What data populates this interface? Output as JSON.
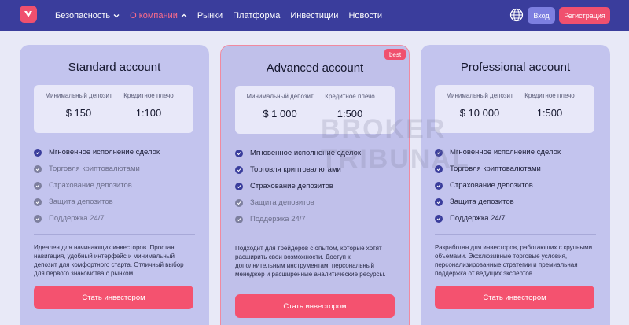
{
  "header": {
    "nav": [
      {
        "label": "Безопасность",
        "has_chevron": true,
        "active": false
      },
      {
        "label": "О компании",
        "has_chevron": true,
        "active": true
      },
      {
        "label": "Рынки"
      },
      {
        "label": "Платформа"
      },
      {
        "label": "Инвестиции"
      },
      {
        "label": "Новости"
      }
    ],
    "login_label": "Вход",
    "register_label": "Регистрация",
    "colors": {
      "bar": "#3a3d9c",
      "accent": "#f0506e",
      "active_nav": "#ff6d8a"
    }
  },
  "watermark": {
    "line1": "BROKER",
    "line2": "TRIBUNAL"
  },
  "cards": [
    {
      "title": "Standard account",
      "min_deposit_label": "Минимальный депозит",
      "min_deposit_value": "$ 150",
      "leverage_label": "Кредитное плечо",
      "leverage_value": "1:100",
      "features": [
        {
          "label": "Мгновенное исполнение сделок",
          "included": true
        },
        {
          "label": "Торговля криптовалютами",
          "included": false
        },
        {
          "label": "Страхование депозитов",
          "included": false
        },
        {
          "label": "Защита депозитов",
          "included": false
        },
        {
          "label": "Поддержка 24/7",
          "included": false
        }
      ],
      "description": "Идеален для начинающих инвесторов. Простая навигация, удобный интерфейс и минимальный депозит для комфортного старта. Отличный выбор для первого знакомства с рынком.",
      "cta_label": "Стать инвестором"
    },
    {
      "title": "Advanced account",
      "badge": "best",
      "min_deposit_label": "Минимальный депозит",
      "min_deposit_value": "$ 1 000",
      "leverage_label": "Кредитное плечо",
      "leverage_value": "1:500",
      "features": [
        {
          "label": "Мгновенное исполнение сделок",
          "included": true
        },
        {
          "label": "Торговля криптовалютами",
          "included": true
        },
        {
          "label": "Страхование депозитов",
          "included": true
        },
        {
          "label": "Защита депозитов",
          "included": false
        },
        {
          "label": "Поддержка 24/7",
          "included": false
        }
      ],
      "description": "Подходит для трейдеров с опытом, которые хотят расширить свои возможности. Доступ к дополнительным инструментам, персональный менеджер и расширенные аналитические ресурсы.",
      "cta_label": "Стать инвестором"
    },
    {
      "title": "Professional account",
      "min_deposit_label": "Минимальный депозит",
      "min_deposit_value": "$ 10 000",
      "leverage_label": "Кредитное плечо",
      "leverage_value": "1:500",
      "features": [
        {
          "label": "Мгновенное исполнение сделок",
          "included": true
        },
        {
          "label": "Торговля криптовалютами",
          "included": true
        },
        {
          "label": "Страхование депозитов",
          "included": true
        },
        {
          "label": "Защита депозитов",
          "included": true
        },
        {
          "label": "Поддержка 24/7",
          "included": true
        }
      ],
      "description": "Разработан для инвесторов, работающих с крупными объемами. Эксклюзивные торговые условия, персонализированные стратегии и премиальная поддержка от ведущих экспертов.",
      "cta_label": "Стать инвестором"
    }
  ]
}
